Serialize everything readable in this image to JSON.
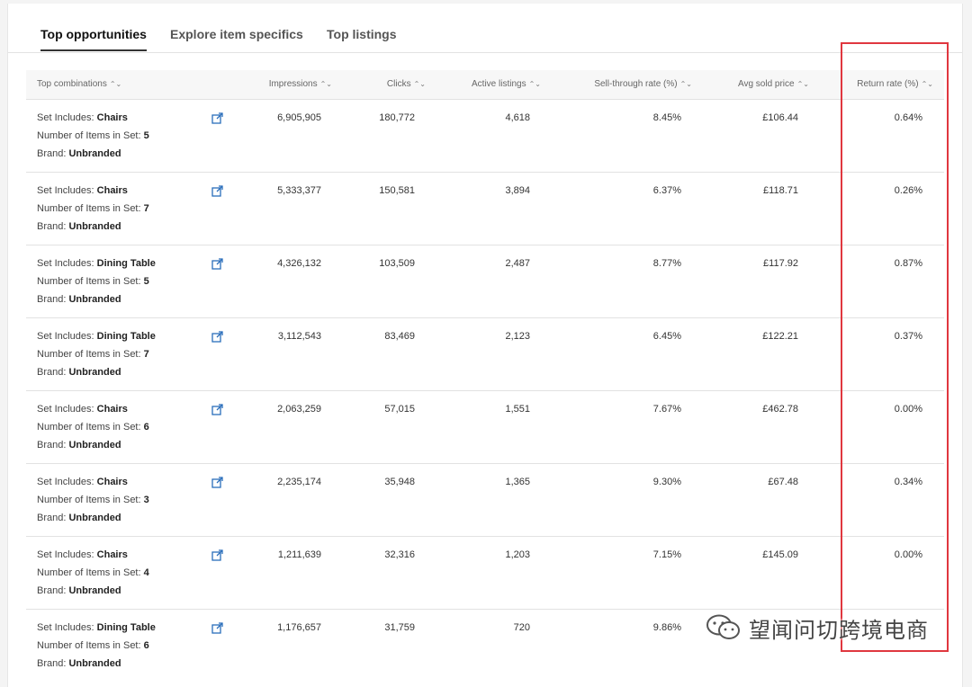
{
  "tabs": [
    {
      "label": "Top opportunities",
      "active": true
    },
    {
      "label": "Explore item specifics",
      "active": false
    },
    {
      "label": "Top listings",
      "active": false
    }
  ],
  "columns": {
    "combo": "Top combinations",
    "impressions": "Impressions",
    "clicks": "Clicks",
    "active": "Active listings",
    "sell_through": "Sell-through rate (%)",
    "avg_price": "Avg sold price",
    "return_rate": "Return rate (%)"
  },
  "attr_labels": {
    "set_includes": "Set Includes:",
    "items_in_set": "Number of Items in Set:",
    "brand": "Brand:"
  },
  "rows": [
    {
      "set": "Chairs",
      "count": "5",
      "brand": "Unbranded",
      "impressions": "6,905,905",
      "clicks": "180,772",
      "active": "4,618",
      "sell_through": "8.45%",
      "avg_price": "£106.44",
      "return_rate": "0.64%"
    },
    {
      "set": "Chairs",
      "count": "7",
      "brand": "Unbranded",
      "impressions": "5,333,377",
      "clicks": "150,581",
      "active": "3,894",
      "sell_through": "6.37%",
      "avg_price": "£118.71",
      "return_rate": "0.26%"
    },
    {
      "set": "Dining Table",
      "count": "5",
      "brand": "Unbranded",
      "impressions": "4,326,132",
      "clicks": "103,509",
      "active": "2,487",
      "sell_through": "8.77%",
      "avg_price": "£117.92",
      "return_rate": "0.87%"
    },
    {
      "set": "Dining Table",
      "count": "7",
      "brand": "Unbranded",
      "impressions": "3,112,543",
      "clicks": "83,469",
      "active": "2,123",
      "sell_through": "6.45%",
      "avg_price": "£122.21",
      "return_rate": "0.37%"
    },
    {
      "set": "Chairs",
      "count": "6",
      "brand": "Unbranded",
      "impressions": "2,063,259",
      "clicks": "57,015",
      "active": "1,551",
      "sell_through": "7.67%",
      "avg_price": "£462.78",
      "return_rate": "0.00%"
    },
    {
      "set": "Chairs",
      "count": "3",
      "brand": "Unbranded",
      "impressions": "2,235,174",
      "clicks": "35,948",
      "active": "1,365",
      "sell_through": "9.30%",
      "avg_price": "£67.48",
      "return_rate": "0.34%"
    },
    {
      "set": "Chairs",
      "count": "4",
      "brand": "Unbranded",
      "impressions": "1,211,639",
      "clicks": "32,316",
      "active": "1,203",
      "sell_through": "7.15%",
      "avg_price": "£145.09",
      "return_rate": "0.00%"
    },
    {
      "set": "Dining Table",
      "count": "6",
      "brand": "Unbranded",
      "impressions": "1,176,657",
      "clicks": "31,759",
      "active": "720",
      "sell_through": "9.86%",
      "avg_price": "",
      "return_rate": ""
    }
  ],
  "watermark": "望闻问切跨境电商",
  "colors": {
    "highlight": "#e0373f",
    "link_icon": "#2a6ebb"
  },
  "icons": {
    "sort": "sort-updown-icon",
    "external": "external-link-icon",
    "wechat": "wechat-icon"
  }
}
